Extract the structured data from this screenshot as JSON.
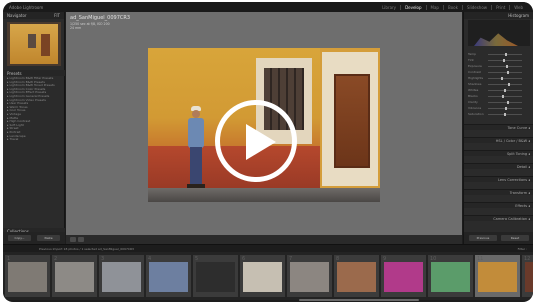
{
  "app": {
    "logo": "Adobe Lightroom"
  },
  "modules": [
    "Library",
    "Develop",
    "Map",
    "Book",
    "Slideshow",
    "Print",
    "Web"
  ],
  "active_module": "Develop",
  "left_panel": {
    "navigator_title": "Navigator",
    "navigator_zoom": "FIT",
    "presets_title": "Presets",
    "snapshots_title": "Snapshots",
    "history_title": "History",
    "collections_title": "Collections",
    "presets": [
      "Lightroom B&W Filter Presets",
      "Lightroom B&W Presets",
      "Lightroom B&W Toned Presets",
      "Lightroom Color Presets",
      "Lightroom Effect Presets",
      "Lightroom General Presets",
      "Lightroom Video Presets",
      "User Presets",
      "Warm Tones",
      "Cool Tones",
      "Vintage",
      "Matte",
      "High Contrast",
      "Soft Light",
      "Street",
      "Portrait",
      "Landscape",
      "Travel"
    ],
    "copy_label": "Copy...",
    "paste_label": "Paste"
  },
  "photo_info": {
    "filename": "ad_SanMiguel_0097CR3",
    "line2": "1/250 sec at f/8, ISO 200",
    "line3": "24 mm"
  },
  "right_panel": {
    "histogram_title": "Histogram",
    "sliders": [
      "Temp",
      "Tint",
      "Exposure",
      "Contrast",
      "Highlights",
      "Shadows",
      "Whites",
      "Blacks",
      "Clarity",
      "Vibrance",
      "Saturation"
    ],
    "slider_values": [
      0.52,
      0.48,
      0.55,
      0.6,
      0.4,
      0.62,
      0.5,
      0.45,
      0.58,
      0.54,
      0.5
    ],
    "sections": [
      "Tone Curve",
      "HSL / Color / B&W",
      "Split Toning",
      "Detail",
      "Lens Corrections",
      "Transform",
      "Effects",
      "Camera Calibration"
    ],
    "previous_label": "Previous",
    "reset_label": "Reset"
  },
  "filmstrip": {
    "info": "Previous Import  18 photos / 1 selected  ad_SanMiguel_0097CR3",
    "filter_label": "Filter :",
    "cells": [
      {
        "idx": "1",
        "color": "#7f7a74"
      },
      {
        "idx": "2",
        "color": "#8d8a86"
      },
      {
        "idx": "3",
        "color": "#8f9298"
      },
      {
        "idx": "4",
        "color": "#6d7fa0"
      },
      {
        "idx": "5",
        "color": "#2d2d2d"
      },
      {
        "idx": "6",
        "color": "#c6bfb2"
      },
      {
        "idx": "7",
        "color": "#8c8681"
      },
      {
        "idx": "8",
        "color": "#9b6a4c"
      },
      {
        "idx": "9",
        "color": "#b13a8a"
      },
      {
        "idx": "10",
        "color": "#5b9c6a"
      },
      {
        "idx": "11",
        "color": "#c28c3a"
      },
      {
        "idx": "12",
        "color": "#6a3a2a"
      }
    ]
  },
  "colors": {
    "accent": "#ffffff",
    "panel": "#2b2b2b",
    "canvas": "#6e6e6e"
  },
  "icons": [
    "play-icon"
  ]
}
